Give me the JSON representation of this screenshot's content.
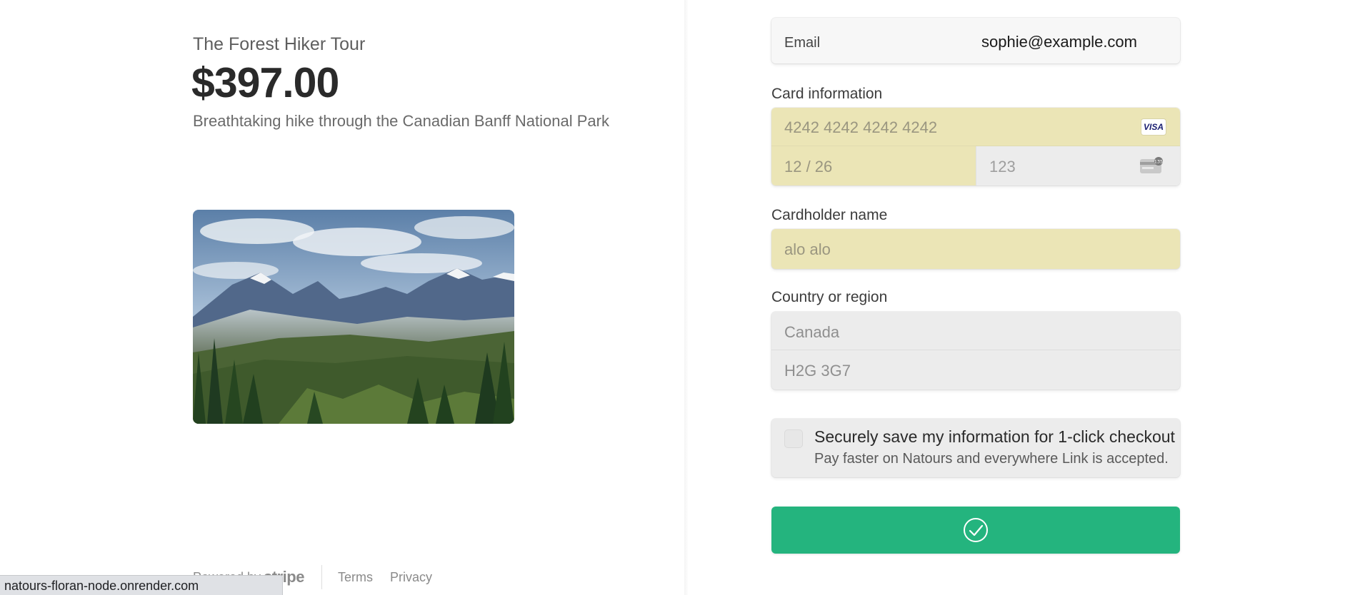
{
  "product": {
    "name": "The Forest Hiker Tour",
    "price": "$397.00",
    "description": "Breathtaking hike through the Canadian Banff National Park"
  },
  "footer": {
    "powered_by": "Powered by",
    "brand": "stripe",
    "terms": "Terms",
    "privacy": "Privacy"
  },
  "status_bar": {
    "url": "natours-floran-node.onrender.com"
  },
  "form": {
    "email_label": "Email",
    "email_value": "sophie@example.com",
    "card_label": "Card information",
    "card_number_placeholder": "4242 4242 4242 4242",
    "card_brand": "VISA",
    "expiry_placeholder": "12 / 26",
    "cvc_placeholder": "123",
    "cvc_icon_text": "135",
    "cardholder_label": "Cardholder name",
    "cardholder_placeholder": "alo alo",
    "country_label": "Country or region",
    "country_value": "Canada",
    "postal_placeholder": "H2G 3G7",
    "save_title": "Securely save my information for 1-click checkout",
    "save_subtitle": "Pay faster on Natours and everywhere Link is accepted."
  },
  "colors": {
    "pay_button": "#24b47e",
    "autofill_field": "#ebe5b6"
  },
  "icons": {
    "pay_button_icon": "check-circle-icon",
    "card_brand_icon": "visa-icon",
    "cvc_icon": "card-cvc-icon"
  }
}
